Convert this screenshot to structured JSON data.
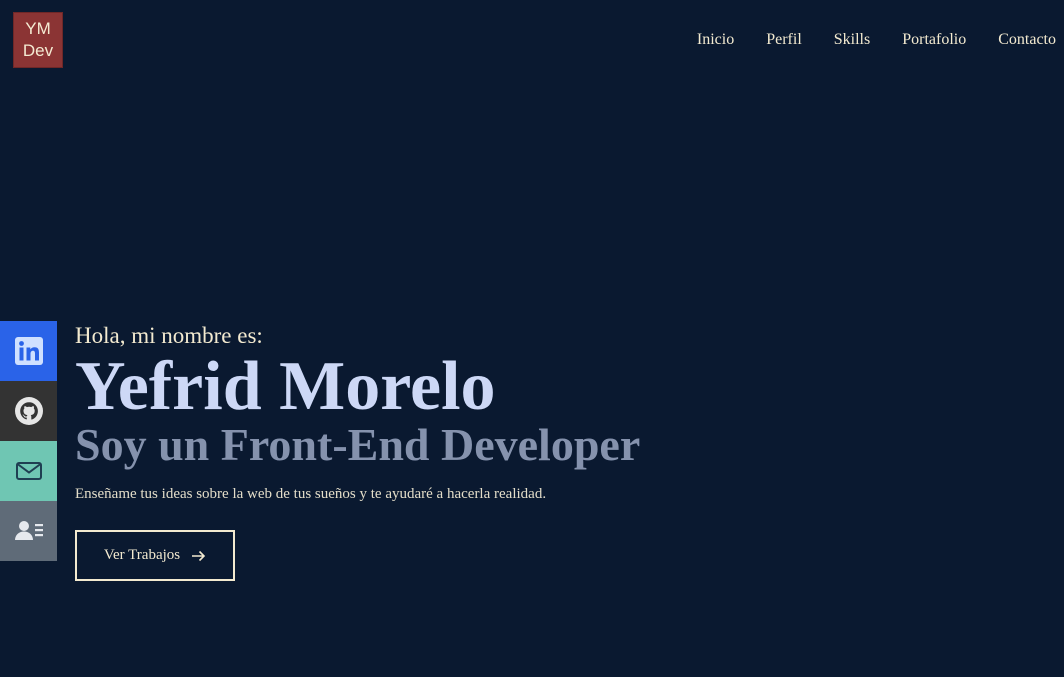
{
  "logo": {
    "line1": "YM",
    "line2": "Dev"
  },
  "nav": {
    "items": [
      {
        "label": "Inicio"
      },
      {
        "label": "Perfil"
      },
      {
        "label": "Skills"
      },
      {
        "label": "Portafolio"
      },
      {
        "label": "Contacto"
      }
    ]
  },
  "social": {
    "items": [
      {
        "icon": "linkedin-icon",
        "color": "#2a63e8"
      },
      {
        "icon": "github-icon",
        "color": "#333333"
      },
      {
        "icon": "mail-icon",
        "color": "#6fc6b3"
      },
      {
        "icon": "contact-card-icon",
        "color": "#5f6b78"
      }
    ]
  },
  "hero": {
    "greeting": "Hola, mi nombre es:",
    "name": "Yefrid Morelo",
    "role": "Soy un Front-End Developer",
    "tagline": "Enseñame tus ideas sobre la web de tus sueños y te ayudaré a hacerla realidad.",
    "cta_label": "Ver Trabajos",
    "cta_icon": "arrow-right-icon"
  },
  "colors": {
    "background": "#0a1930",
    "logo_bg": "#8b3434",
    "text_light": "#f3ead0",
    "name": "#cdd8f6",
    "role": "#8592ad"
  }
}
